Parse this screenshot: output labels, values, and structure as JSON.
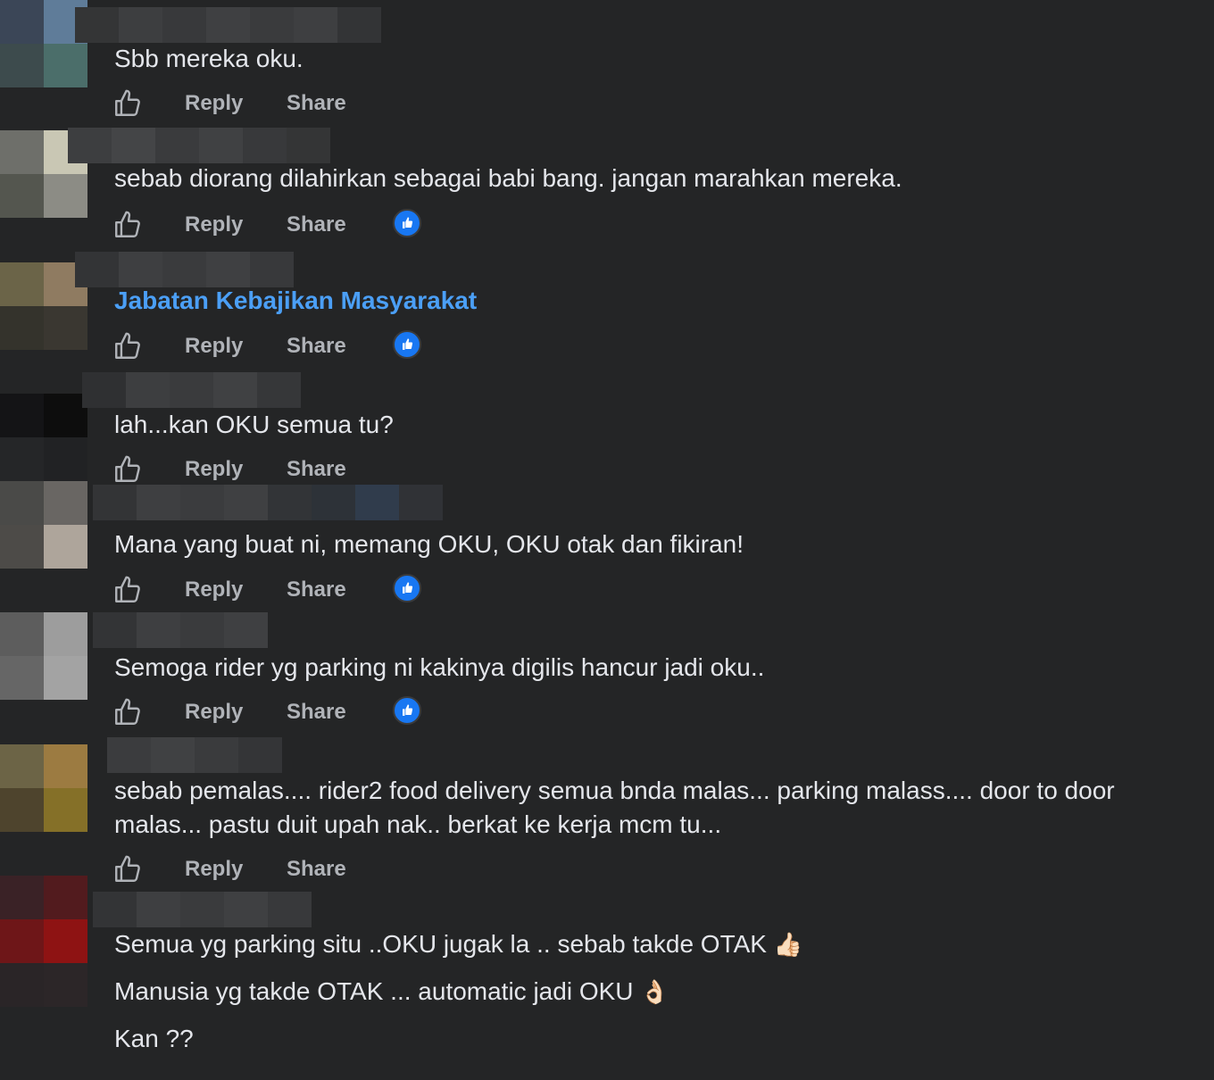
{
  "actions": {
    "reply": "Reply",
    "share": "Share"
  },
  "comments": [
    {
      "text": "Sbb mereka oku."
    },
    {
      "text": "sebab diorang dilahirkan sebagai babi bang. jangan marahkan mereka."
    },
    {
      "text": "Jabatan Kebajikan Masyarakat"
    },
    {
      "text": "lah...kan OKU semua tu?"
    },
    {
      "text": "Mana yang buat ni, memang OKU, OKU otak dan fikiran!"
    },
    {
      "text": "Semoga rider yg parking ni kakinya digilis hancur jadi oku.."
    },
    {
      "text": "sebab pemalas.... rider2 food delivery semua bnda malas... parking malass.... door to door malas... pastu duit upah nak.. berkat ke kerja mcm tu..."
    },
    {
      "lines": [
        {
          "text": "Semua yg parking situ ..OKU jugak la .. sebab takde OTAK",
          "emoji": "👍🏻"
        },
        {
          "text": "Manusia yg takde OTAK ... automatic jadi OKU",
          "emoji": "👌🏻"
        },
        {
          "text": "Kan ??"
        }
      ]
    }
  ]
}
